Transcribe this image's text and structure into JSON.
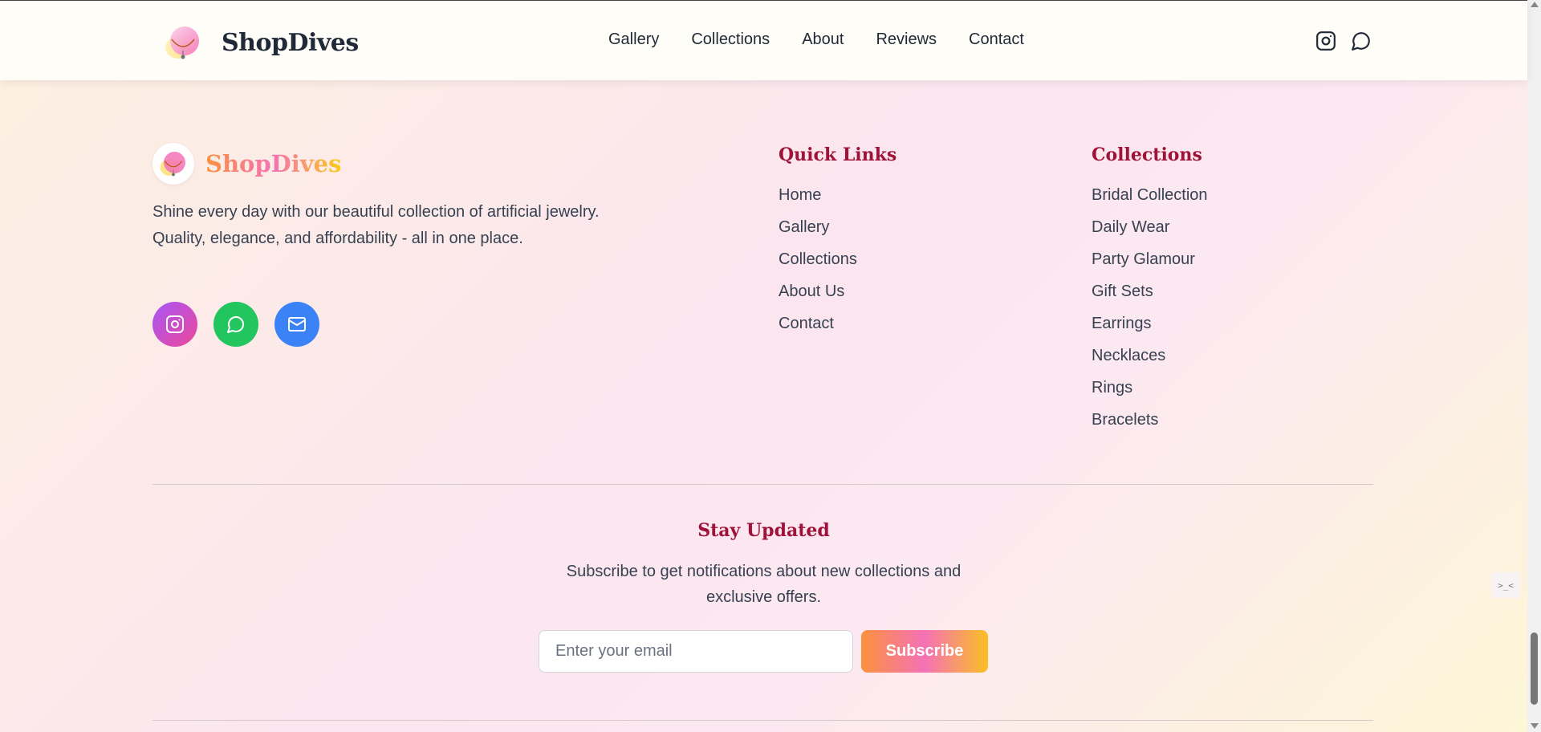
{
  "header": {
    "brand_name": "ShopDives",
    "nav": [
      {
        "label": "Gallery"
      },
      {
        "label": "Collections"
      },
      {
        "label": "About"
      },
      {
        "label": "Reviews"
      },
      {
        "label": "Contact"
      }
    ],
    "icons": [
      "instagram-icon",
      "message-circle-icon"
    ]
  },
  "footer": {
    "brand_name": "ShopDives",
    "description": "Shine every day with our beautiful collection of artificial jewelry. Quality, elegance, and affordability - all in one place.",
    "socials": [
      {
        "icon": "instagram-icon",
        "color": "#c04fd8"
      },
      {
        "icon": "whatsapp-icon",
        "color": "#22c55e"
      },
      {
        "icon": "mail-icon",
        "color": "#3b82f6"
      }
    ],
    "quick_links": {
      "title": "Quick Links",
      "items": [
        {
          "label": "Home"
        },
        {
          "label": "Gallery"
        },
        {
          "label": "Collections"
        },
        {
          "label": "About Us"
        },
        {
          "label": "Contact"
        }
      ]
    },
    "collections": {
      "title": "Collections",
      "items": [
        {
          "label": "Bridal Collection"
        },
        {
          "label": "Daily Wear"
        },
        {
          "label": "Party Glamour"
        },
        {
          "label": "Gift Sets"
        },
        {
          "label": "Earrings"
        },
        {
          "label": "Necklaces"
        },
        {
          "label": "Rings"
        },
        {
          "label": "Bracelets"
        }
      ]
    },
    "newsletter": {
      "title": "Stay Updated",
      "text": "Subscribe to get notifications about new collections and exclusive offers.",
      "placeholder": "Enter your email",
      "button": "Subscribe"
    }
  },
  "colors": {
    "accent_heading": "#9f1239",
    "brand_gradient": [
      "#fb923c",
      "#f472b6",
      "#facc15"
    ]
  }
}
